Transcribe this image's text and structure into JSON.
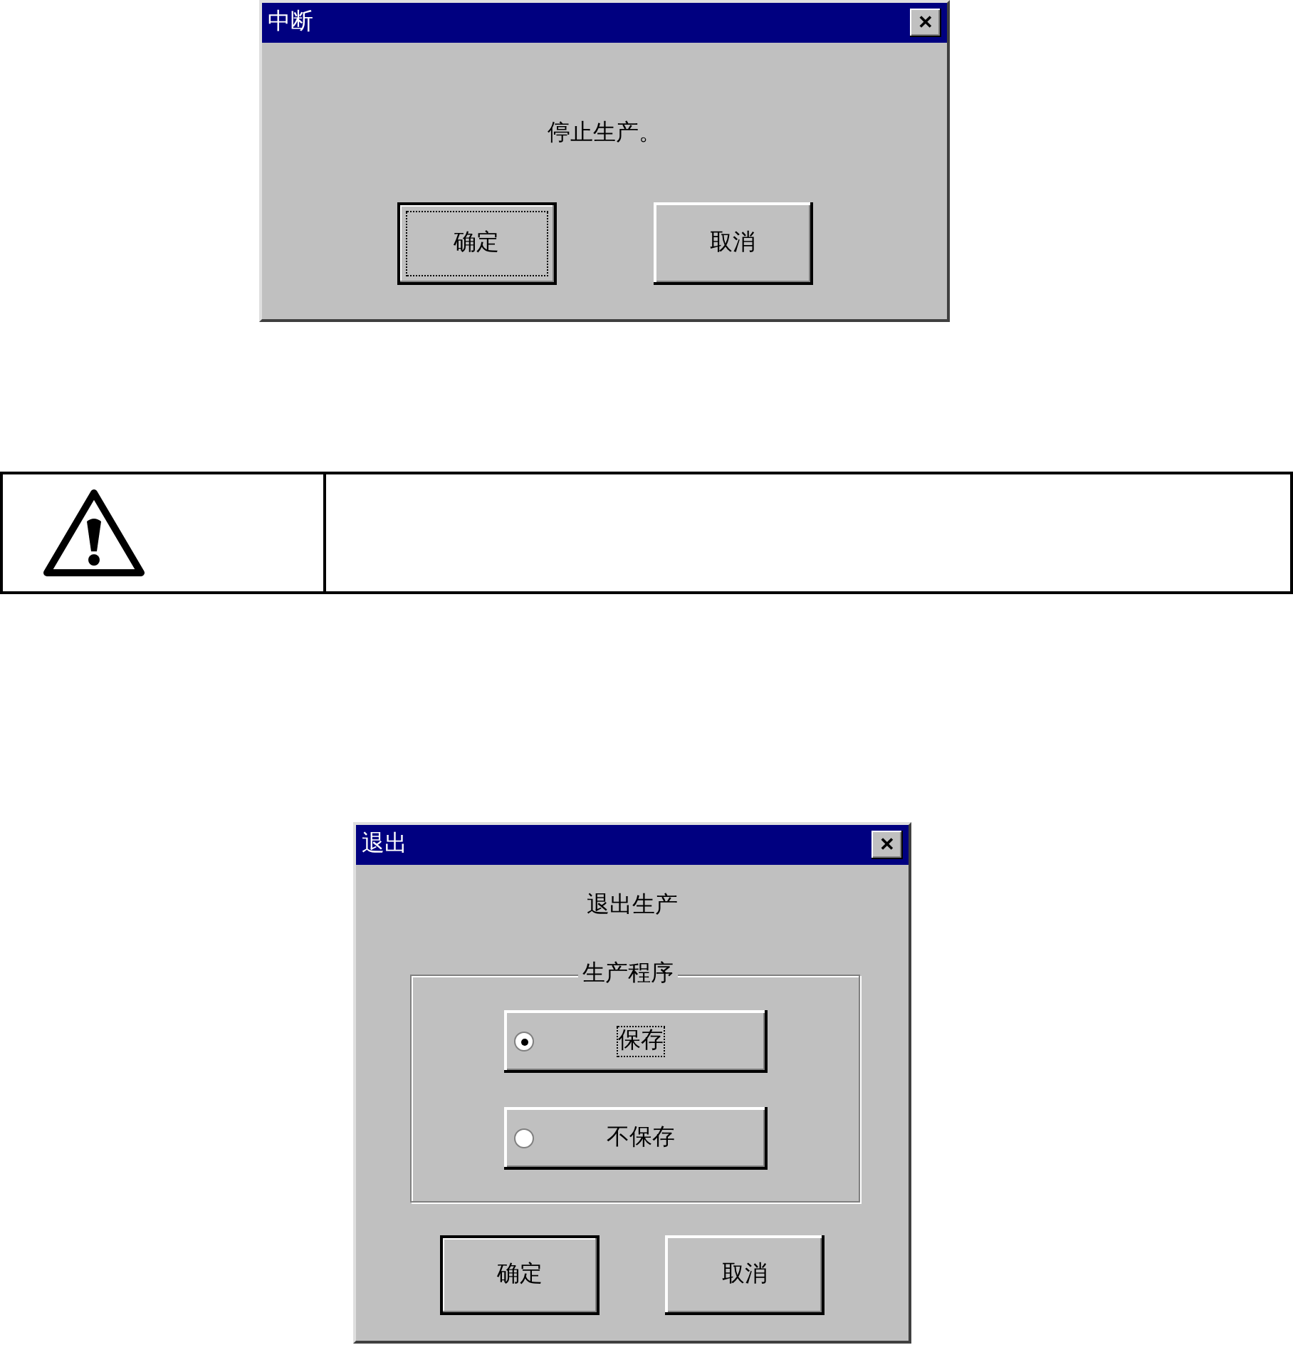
{
  "dialogs": [
    {
      "title": "中断",
      "close_glyph": "✕",
      "message": "停止生产。",
      "buttons": [
        {
          "label": "确定",
          "default": true,
          "focused": true
        },
        {
          "label": "取消",
          "default": false,
          "focused": false
        }
      ]
    },
    {
      "title": "退出",
      "close_glyph": "✕",
      "message": "退出生产",
      "group": {
        "legend": "生产程序",
        "options": [
          {
            "label": "保存",
            "selected": true,
            "focused": true
          },
          {
            "label": "不保存",
            "selected": false,
            "focused": false
          }
        ]
      },
      "buttons": [
        {
          "label": "确定",
          "default": true,
          "focused": false
        },
        {
          "label": "取消",
          "default": false,
          "focused": false
        }
      ]
    }
  ]
}
